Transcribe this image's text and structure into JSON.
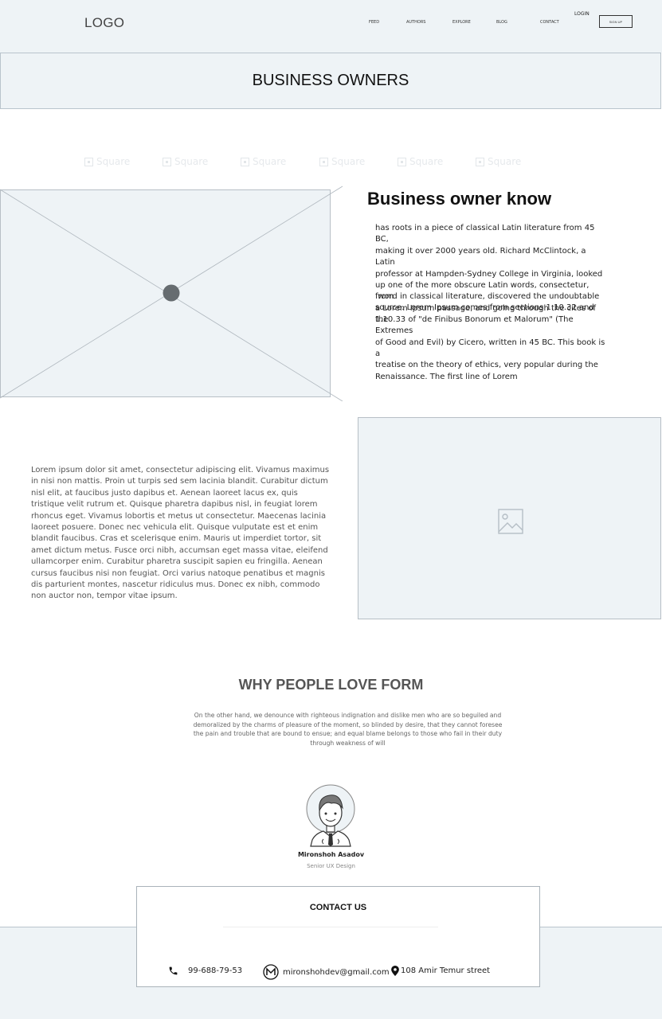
{
  "header": {
    "logo": "LOGO",
    "nav": [
      "FEED",
      "AUTHORS",
      "EXPLORE",
      "BLOG",
      "CONTACT"
    ],
    "login": "LOGIN",
    "signup": "SIGN UP"
  },
  "banner": {
    "title": "BUSINESS OWNERS"
  },
  "partner_logos": [
    "Square",
    "Square",
    "Square",
    "Square",
    "Square",
    "Square"
  ],
  "section1": {
    "title": "Business owner know",
    "paragraph1": "has roots in a piece of classical Latin literature from 45 BC,\nmaking it over 2000 years old. Richard McClintock, a Latin\nprofessor at Hampden-Sydney College in Virginia, looked\nup one of the more obscure Latin words, consectetur, from\na Lorem Ipsum passage, and going through the cites of the",
    "paragraph2": " word in classical literature, discovered the undoubtable\nsource. Lorem Ipsum comes from sections 1.10.32 and\n1.10.33 of \"de Finibus Bonorum et Malorum\" (The Extremes\nof Good and Evil) by Cicero, written in 45 BC. This book is a\ntreatise on the theory of ethics, very popular during the\nRenaissance. The first line of Lorem"
  },
  "section2": {
    "text": "Lorem ipsum dolor sit amet, consectetur adipiscing elit. Vivamus maximus in nisi non mattis. Proin ut turpis sed sem lacinia blandit. Curabitur dictum nisl elit, at faucibus justo dapibus et. Aenean laoreet lacus ex, quis tristique velit rutrum et. Quisque pharetra dapibus nisl, in feugiat lorem rhoncus eget. Vivamus lobortis et metus ut consectetur. Maecenas lacinia laoreet posuere. Donec nec vehicula elit. Quisque vulputate est et enim blandit faucibus. Cras et scelerisque enim. Mauris ut imperdiet tortor, sit amet dictum metus. Fusce orci nibh, accumsan eget massa vitae, eleifend ullamcorper enim. Curabitur pharetra suscipit sapien eu fringilla. Aenean cursus faucibus nisi non feugiat. Orci varius natoque penatibus et magnis dis parturient montes, nascetur ridiculus mus. Donec ex nibh, commodo non auctor non, tempor vitae ipsum."
  },
  "testimonials": {
    "title": "WHY PEOPLE LOVE FORM",
    "text": "On the other hand, we denounce with righteous indignation and dislike men who are so beguiled and demoralized by the charms of pleasure of the moment, so blinded by desire, that they cannot foresee the pain and trouble that are bound to ensue; and equal blame belongs to those who fail in their duty through weakness of will",
    "person_name": "Mironshoh Asadov",
    "person_role": "Senior UX Design"
  },
  "contact": {
    "title": "CONTACT US",
    "phone": "99-688-79-53",
    "email": "mironshohdev@gmail.com",
    "address": "108 Amir Temur street"
  },
  "colors": {
    "panel_bg": "#eef3f6",
    "border": "#b9c4cc",
    "heading_gray": "#555555"
  }
}
